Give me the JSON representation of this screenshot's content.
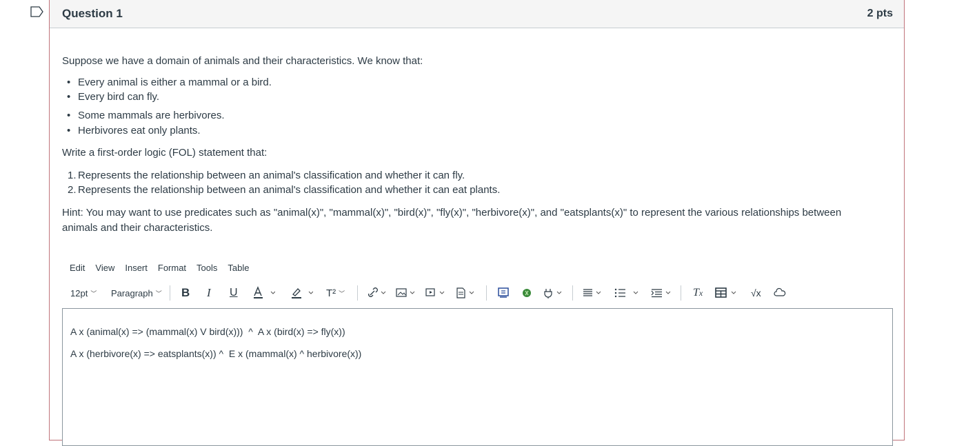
{
  "question": {
    "title": "Question 1",
    "points": "2 pts",
    "intro": "Suppose we have a domain of animals and their characteristics. We know that:",
    "facts": [
      "Every animal is either a mammal or a bird.",
      "Every bird can fly.",
      "Some mammals are herbivores.",
      "Herbivores eat only plants."
    ],
    "task": "Write a first-order logic (FOL) statement that:",
    "requirements": [
      "Represents the relationship between an animal's classification and whether it can fly.",
      "Represents the relationship between an animal's classification and whether it can eat plants."
    ],
    "hint": "Hint: You may want to use predicates such as \"animal(x)\", \"mammal(x)\", \"bird(x)\", \"fly(x)\", \"herbivore(x)\", and \"eatsplants(x)\" to represent the various relationships between animals and their characteristics."
  },
  "editor": {
    "menu": [
      "Edit",
      "View",
      "Insert",
      "Format",
      "Tools",
      "Table"
    ],
    "font_size": "12pt",
    "block_format": "Paragraph",
    "answer_lines": [
      "A x (animal(x) => (mammal(x) V bird(x)))  ^  A x (bird(x) => fly(x))",
      "A x (herbivore(x) => eatsplants(x)) ^  E x (mammal(x) ^ herbivore(x))"
    ]
  },
  "colors": {
    "border_accent": "#c0737a",
    "text": "#2d3b45",
    "header_bg": "#f5f5f5"
  }
}
